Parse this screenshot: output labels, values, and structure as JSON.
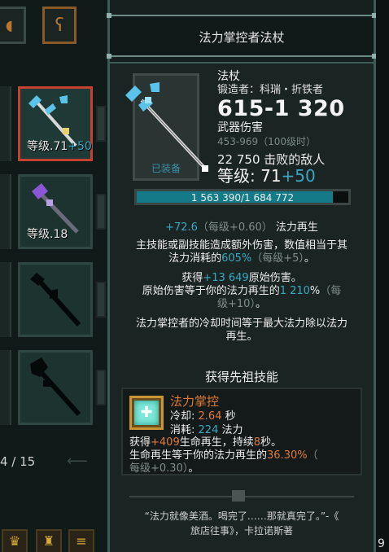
{
  "inventory": {
    "top_buttons": [
      {
        "icon": "book-icon",
        "glyph": "◖"
      },
      {
        "icon": "rune-icon",
        "glyph": "ʕ"
      }
    ],
    "slots": [
      {
        "label": "等级.71",
        "plus": "+50",
        "icon": "staff-blue-icon",
        "selected": true
      },
      {
        "label": "等级.18",
        "plus": "",
        "icon": "staff-purple-icon",
        "selected": false
      },
      {
        "label": "",
        "plus": "",
        "icon": "staff-dark-icon",
        "selected": false
      },
      {
        "label": "",
        "plus": "",
        "icon": "staff-thorn-icon",
        "selected": false
      }
    ],
    "page_count": "4 / 15",
    "bottom_buttons": [
      "trophy-icon",
      "cup-icon",
      "stack-icon"
    ]
  },
  "tooltip": {
    "title": "法力掌控者法杖",
    "equipped_label": "已装备",
    "item_type": "法杖",
    "forger": "锻造者：科瑞・折铁者",
    "damage": "615-1 320",
    "damage_label": "武器伤害",
    "damage_range": "453-969（100级时）",
    "kills": "22 750 击败的敌人",
    "level_label": "等级: 71",
    "level_plus": "+50",
    "xp_text": "1 563 390/1 684 772",
    "xp_fraction": 0.928,
    "stats": {
      "mana_regen_value": "+72.6",
      "mana_regen_per_level": "（每级+0.60）",
      "mana_regen_name": "法力再生",
      "skill_damage_line1": "主技能或副技能造成额外伤害，数值相当于其",
      "skill_damage_line2a": "法力消耗的",
      "skill_damage_percent": "605%",
      "skill_damage_per_level": "（每级+5）",
      "skill_damage_end": "。",
      "base_gain_a": "获得",
      "base_gain_value": "+13 649",
      "base_gain_b": "原始伤害。",
      "base_equal_a": "原始伤害等于你的法力再生的",
      "base_equal_value": "1 210",
      "base_equal_pct": "%",
      "base_equal_per_level_a": "（每",
      "base_equal_per_level_b": "级+10）",
      "base_equal_end": "。",
      "cooldown_line1": "法力掌控者的冷却时间等于最大法力除以法力",
      "cooldown_line2": "再生。"
    },
    "ancestral_header": "获得先祖技能",
    "skill": {
      "name": "法力掌控",
      "cooldown_label": "冷却:",
      "cooldown_value": "2.64",
      "cooldown_unit": "秒",
      "cost_label": "消耗:",
      "cost_value": "224",
      "cost_unit": "法力",
      "desc1_a": "获得",
      "desc1_value": "+409",
      "desc1_b": "生命再生，持续",
      "desc1_sec": "8",
      "desc1_c": "秒。",
      "desc2_a": "生命再生等于你的法力再生的",
      "desc2_value": "36.30%",
      "desc2_b": "（",
      "desc3": "每级+0.30）",
      "desc3_end": "。"
    },
    "quote_line1": "“法力就像美酒。喝完了……那就真完了。”-《",
    "quote_line2": "旅店往事》，卡拉诺斯著"
  },
  "edge_number": "9",
  "colors": {
    "accent_cyan": "#38a9c2",
    "accent_orange": "#e07a36",
    "selected_border": "#c6412e",
    "xp_fill": "#157a88"
  }
}
